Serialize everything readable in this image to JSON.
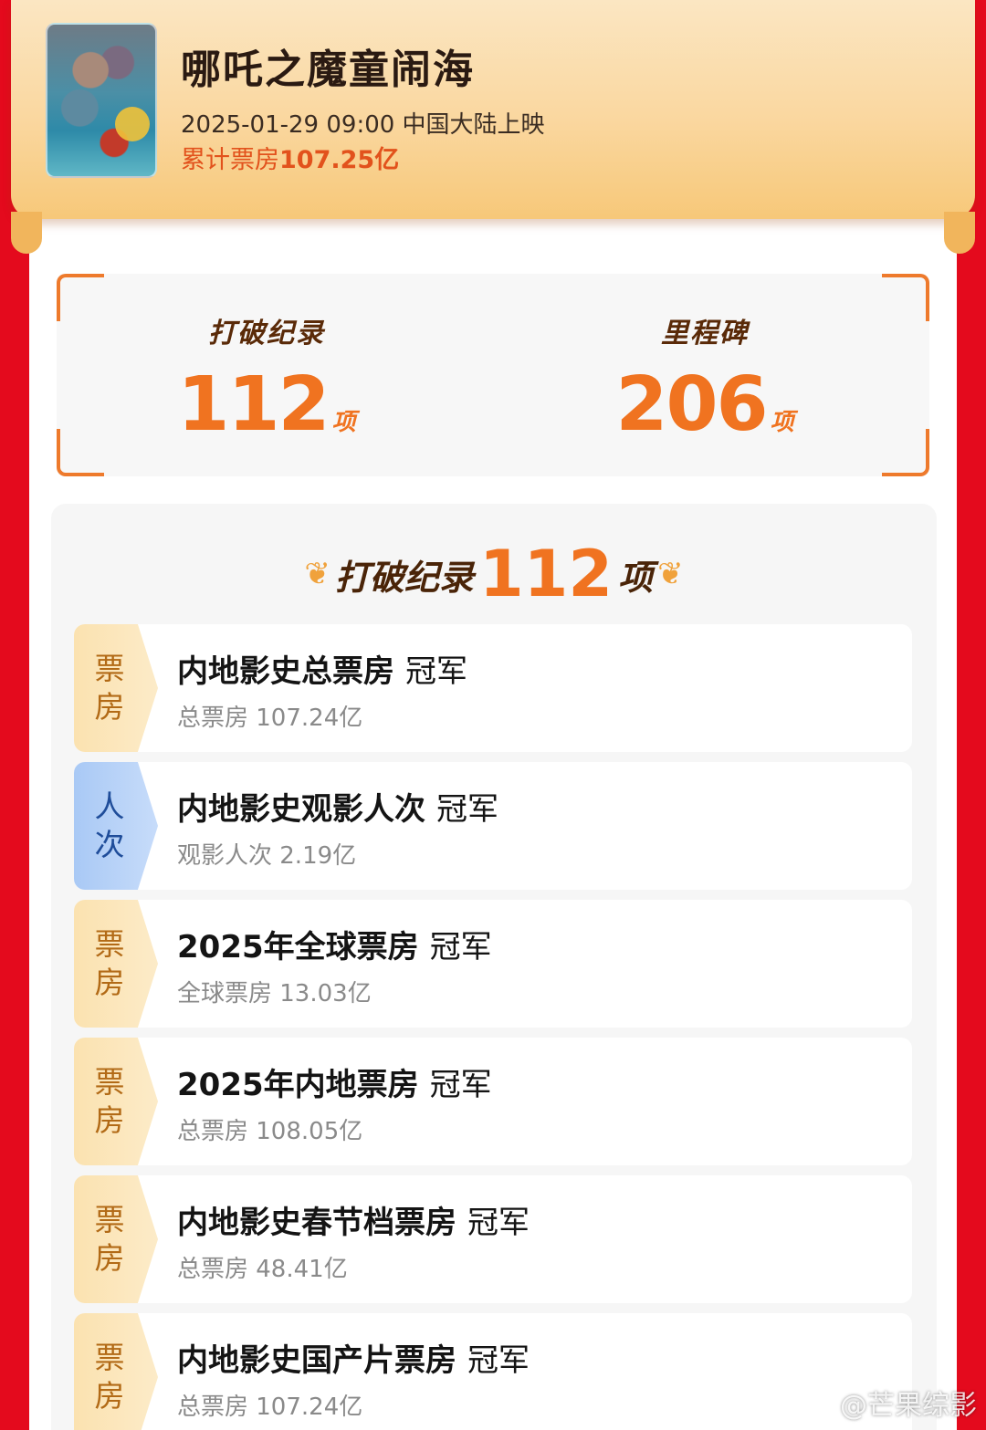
{
  "movie": {
    "title": "哪吒之魔童闹海",
    "release": "2025-01-29 09:00 中国大陆上映",
    "box_office_prefix": "累计票房",
    "box_office_value": "107.25亿"
  },
  "stats": {
    "records_label": "打破纪录",
    "records_value": "112",
    "records_unit": "项",
    "milestones_label": "里程碑",
    "milestones_value": "206",
    "milestones_unit": "项"
  },
  "section": {
    "label": "打破纪录",
    "count": "112",
    "unit": "项"
  },
  "records": [
    {
      "tag1": "票",
      "tag2": "房",
      "tag_color": "gold",
      "title": "内地影史总票房",
      "rank": "冠军",
      "sub": "总票房 107.24亿"
    },
    {
      "tag1": "人",
      "tag2": "次",
      "tag_color": "blue",
      "title": "内地影史观影人次",
      "rank": "冠军",
      "sub": "观影人次 2.19亿"
    },
    {
      "tag1": "票",
      "tag2": "房",
      "tag_color": "gold",
      "title": "2025年全球票房",
      "rank": "冠军",
      "sub": "全球票房 13.03亿"
    },
    {
      "tag1": "票",
      "tag2": "房",
      "tag_color": "gold",
      "title": "2025年内地票房",
      "rank": "冠军",
      "sub": "总票房 108.05亿"
    },
    {
      "tag1": "票",
      "tag2": "房",
      "tag_color": "gold",
      "title": "内地影史春节档票房",
      "rank": "冠军",
      "sub": "总票房 48.41亿"
    },
    {
      "tag1": "票",
      "tag2": "房",
      "tag_color": "gold",
      "title": "内地影史国产片票房",
      "rank": "冠军",
      "sub": "总票房 107.24亿"
    }
  ],
  "watermark": "@芒果综影"
}
